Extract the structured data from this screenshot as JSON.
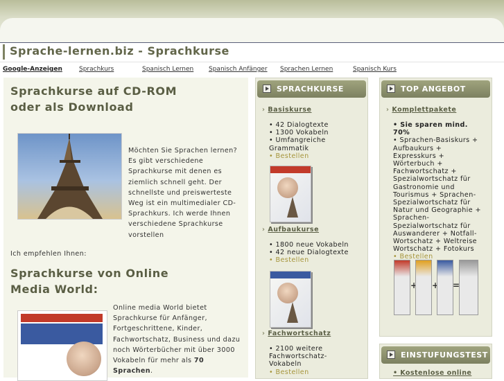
{
  "site_title": "Sprache-lernen.biz - Sprachkurse",
  "nav": {
    "ads_label": "Google-Anzeigen",
    "links": [
      "Sprachkurs",
      "Spanisch Lernen",
      "Spanisch Anfänger",
      "Sprachen Lernen",
      "Spanisch Kurs"
    ]
  },
  "main": {
    "heading1": "Sprachkurse auf CD-ROM oder als Download",
    "intro": "Möchten Sie Sprachen lernen? Es gibt verschiedene Sprachkurse mit denen es ziemlich schnell geht. Der schnellste und preiswerteste Weg ist ein multimedialer CD-Sprachkurs. Ich werde Ihnen verschiedene Sprachkurse vorstellen",
    "recommend": "Ich empfehlen Ihnen:",
    "heading2": "Sprachkurse von Online Media World:",
    "omw_text": "Online media World bietet Sprachkurse für Anfänger, Fortgeschrittene, Kinder, Fachwortschatz, Business und dazu noch Wörterbücher mit über 3000 Vokabeln für mehr als",
    "omw_bold": "70 Sprachen",
    "omw_end": "."
  },
  "sprachkurse": {
    "header": "SPRACHKURSE",
    "sections": [
      {
        "title": "Basiskurse",
        "items": [
          "• 42 Dialogtexte",
          "• 1300 Vokabeln",
          "• Umfangreiche Grammatik"
        ],
        "order": "• Bestellen"
      },
      {
        "title": "Aufbaukurse",
        "items": [
          "• 1800 neue Vokabeln",
          "• 42 neue Dialogtexte"
        ],
        "order": "• Bestellen"
      },
      {
        "title": "Fachwortschatz",
        "items": [
          "• 2100 weitere Fachwortschatz-Vokabeln"
        ],
        "order": "• Bestellen"
      }
    ]
  },
  "top_angebot": {
    "header": "TOP ANGEBOT",
    "section_title": "Komplettpakete",
    "highlight": "• Sie sparen mind. 70%",
    "description": "• Sprachen-Basiskurs + Aufbaukurs + Expresskurs + Wörterbuch + Fachwortschatz + Spezialwortschatz für Gastronomie und Tourismus + Sprachen-Spezialwortschatz für Natur und Geographie + Sprachen-Spezialwortschatz für Auswanderer + Notfall-Wortschatz + Weltreise Wortschatz + Fotokurs",
    "order": "• Bestellen",
    "combo_ops": [
      "+",
      "+",
      "="
    ]
  },
  "einstufungstest": {
    "header": "EINSTUFUNGSTEST",
    "item": "• Kostenlose online"
  },
  "icons": {
    "chevron": "›",
    "header_button": "play-button-icon"
  },
  "colors": {
    "heading": "#5a5e44",
    "header_bar": "#7c8060",
    "order_link": "#a6953c",
    "panel": "#ebecdd"
  }
}
